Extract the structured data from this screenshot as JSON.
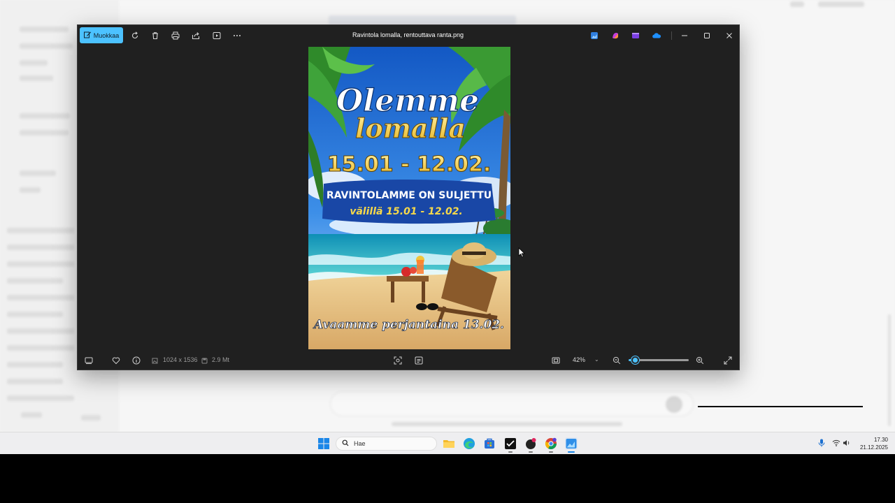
{
  "window": {
    "file_name": "Ravintola lomalla, rentouttava ranta.png",
    "edit_label": "Muokkaa",
    "dimensions": "1024 x 1536",
    "file_size": "2.9 Mt",
    "zoom_value": "42%",
    "zoom_slider_fraction": 0.1
  },
  "poster": {
    "line1": "Olemme",
    "line2": "lomalla",
    "dates": "15.01 - 12.02.",
    "banner_line1": "RAVINTOLAMME ON SULJETTU",
    "banner_line2": "välillä 15.01 - 12.02.",
    "footer": "Avaamme perjantaina 13.02."
  },
  "taskbar": {
    "search_placeholder": "Hae",
    "time": "17.30",
    "date": "21.12.2025"
  },
  "colors": {
    "accent": "#4cc2ff",
    "viewer_bg": "#202020",
    "sky": "#1f6fd1",
    "poster_gold": "#f4d03f"
  }
}
